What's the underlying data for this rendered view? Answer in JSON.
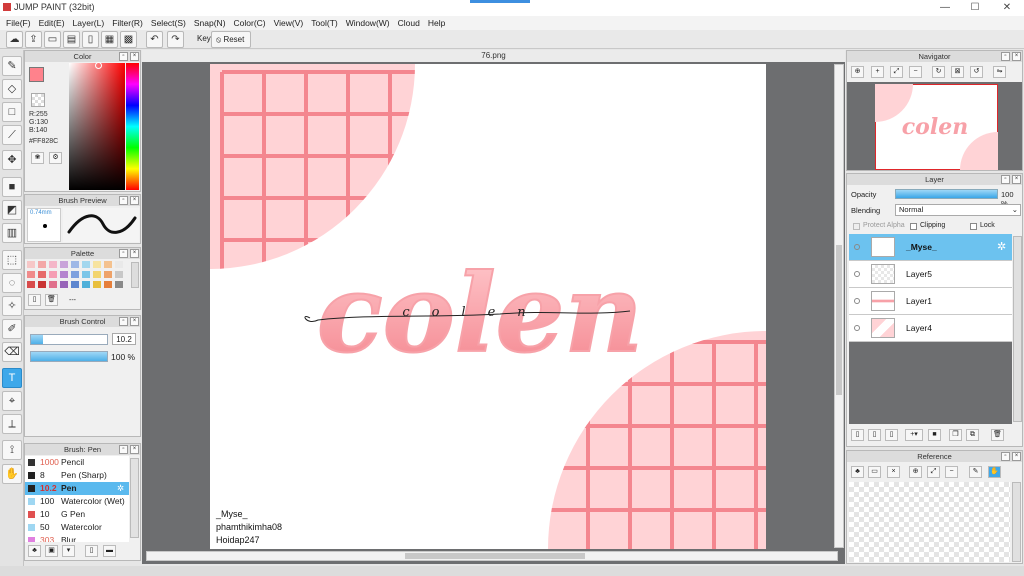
{
  "window": {
    "title": "JUMP PAINT (32bit)",
    "controls": [
      "—",
      "☐",
      "✕"
    ]
  },
  "menu": [
    "File(F)",
    "Edit(E)",
    "Layer(L)",
    "Filter(R)",
    "Select(S)",
    "Snap(N)",
    "Color(C)",
    "View(V)",
    "Tool(T)",
    "Window(W)",
    "Cloud",
    "Help"
  ],
  "toolbar": {
    "key_label": "Key",
    "reset_label": "Reset"
  },
  "color_panel": {
    "title": "Color",
    "r": "R:255",
    "g": "G:130",
    "b": "B:140",
    "hex": "#FF828C",
    "current_color": "#ff828c"
  },
  "brush_preview": {
    "title": "Brush Preview",
    "size": "0.74mm"
  },
  "palette": {
    "title": "Palette",
    "more": "---"
  },
  "brush_control": {
    "title": "Brush Control",
    "size_value": "10.2",
    "opacity_value": "100 %"
  },
  "brush_list": {
    "title": "Brush: Pen",
    "items": [
      {
        "size": "1000",
        "name": "Pencil",
        "color": "#333333"
      },
      {
        "size": "8",
        "name": "Pen (Sharp)",
        "color": "#222222"
      },
      {
        "size": "10.2",
        "name": "Pen",
        "color": "#222222"
      },
      {
        "size": "100",
        "name": "Watercolor (Wet)",
        "color": "#9fd7f2"
      },
      {
        "size": "10",
        "name": "G Pen",
        "color": "#e05050"
      },
      {
        "size": "50",
        "name": "Watercolor",
        "color": "#9fd7f2"
      },
      {
        "size": "303",
        "name": "Blur",
        "color": "#e080e0"
      }
    ]
  },
  "document": {
    "tab": "76.png",
    "lettering": "colen",
    "script_line": "colen",
    "credits": [
      "_Myse_",
      "phamthikimha08",
      "Hoidap247"
    ]
  },
  "navigator": {
    "title": "Navigator"
  },
  "layer_panel": {
    "title": "Layer",
    "opacity_label": "Opacity",
    "opacity_value": "100 %",
    "blending_label": "Blending",
    "blending_value": "Normal",
    "protect_alpha": "Protect Alpha",
    "clipping": "Clipping",
    "lock": "Lock",
    "layers": [
      "_Myse_",
      "Layer5",
      "Layer1",
      "Layer4"
    ]
  },
  "reference": {
    "title": "Reference"
  }
}
